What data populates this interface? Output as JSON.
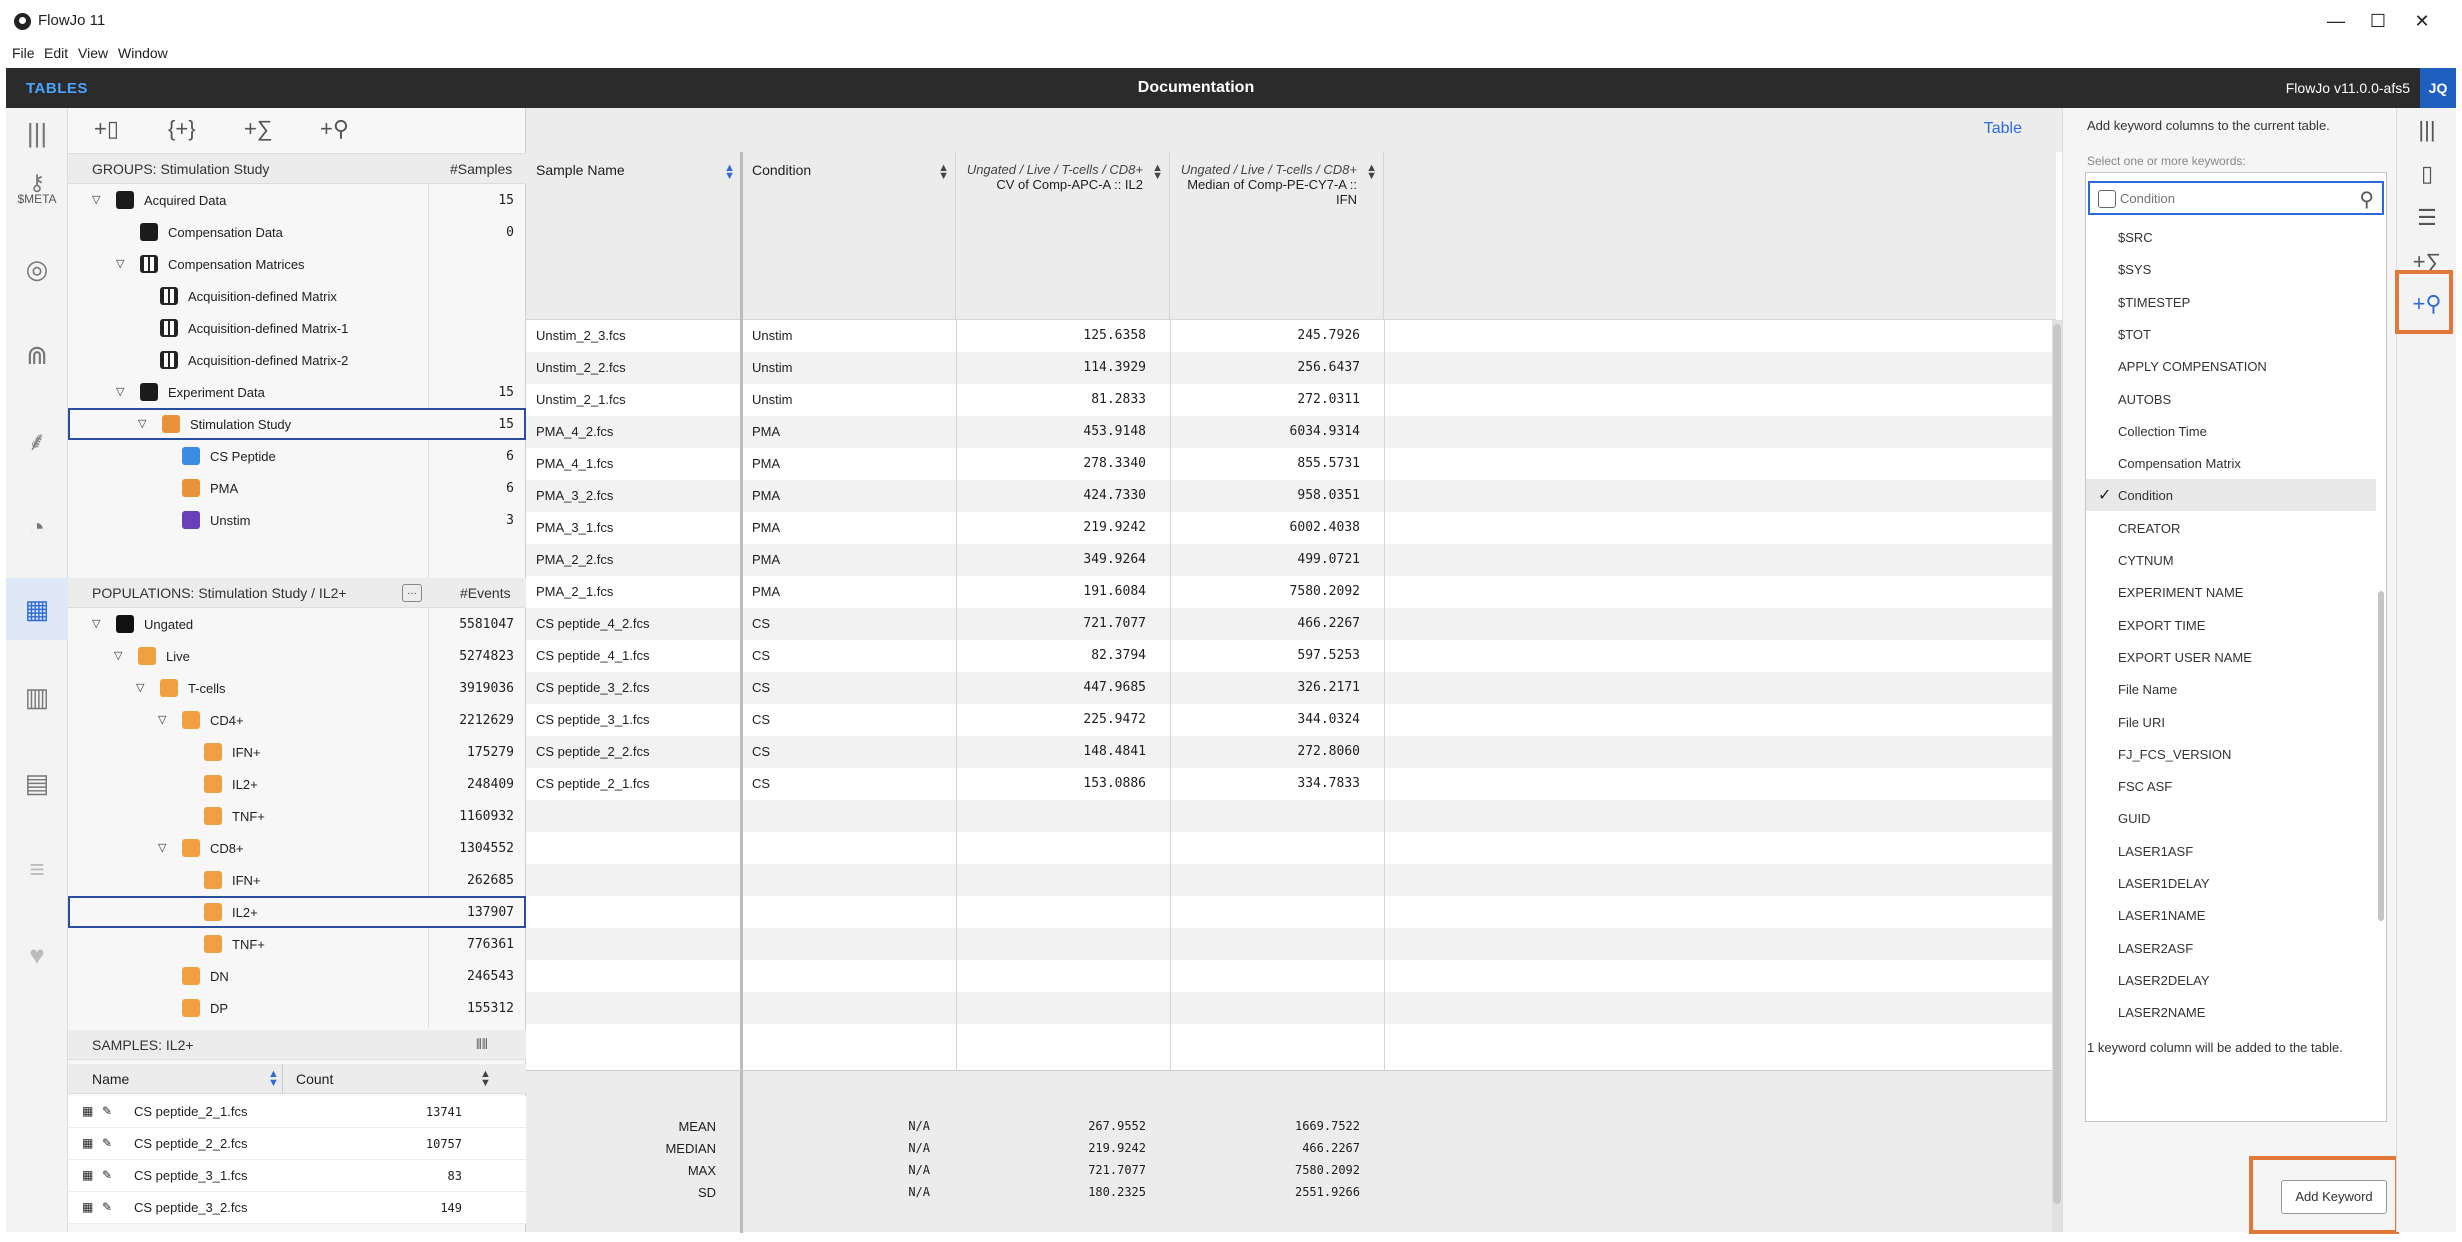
{
  "window": {
    "title": "FlowJo 11",
    "minimize": "—",
    "maximize": "☐",
    "close": "✕"
  },
  "menu": [
    "File",
    "Edit",
    "View",
    "Window"
  ],
  "topbar": {
    "section": "TABLES",
    "document": "Documentation",
    "version": "FlowJo v11.0.0-afs5",
    "user": "JQ"
  },
  "leftrail": {
    "meta_label": "$META"
  },
  "groups": {
    "header": "GROUPS: Stimulation Study",
    "count_header": "#Samples",
    "rows": [
      {
        "name": "Acquired Data",
        "value": "15"
      },
      {
        "name": "Compensation Data",
        "value": "0"
      },
      {
        "name": "Compensation Matrices",
        "value": ""
      },
      {
        "name": "Acquisition-defined Matrix",
        "value": ""
      },
      {
        "name": "Acquisition-defined Matrix-1",
        "value": ""
      },
      {
        "name": "Acquisition-defined Matrix-2",
        "value": ""
      },
      {
        "name": "Experiment Data",
        "value": "15"
      },
      {
        "name": "Stimulation Study",
        "value": "15"
      },
      {
        "name": "CS Peptide",
        "value": "6"
      },
      {
        "name": "PMA",
        "value": "6"
      },
      {
        "name": "Unstim",
        "value": "3"
      }
    ]
  },
  "populations": {
    "header": "POPULATIONS: Stimulation Study / IL2+",
    "count_header": "#Events",
    "rows": [
      {
        "name": "Ungated",
        "value": "5581047"
      },
      {
        "name": "Live",
        "value": "5274823"
      },
      {
        "name": "T-cells",
        "value": "3919036"
      },
      {
        "name": "CD4+",
        "value": "2212629"
      },
      {
        "name": "IFN+",
        "value": "175279"
      },
      {
        "name": "IL2+",
        "value": "248409"
      },
      {
        "name": "TNF+",
        "value": "1160932"
      },
      {
        "name": "CD8+",
        "value": "1304552"
      },
      {
        "name": "IFN+",
        "value": "262685"
      },
      {
        "name": "IL2+",
        "value": "137907"
      },
      {
        "name": "TNF+",
        "value": "776361"
      },
      {
        "name": "DN",
        "value": "246543"
      },
      {
        "name": "DP",
        "value": "155312"
      }
    ]
  },
  "samples": {
    "header": "SAMPLES: IL2+",
    "col_name": "Name",
    "col_count": "Count",
    "rows": [
      {
        "name": "CS peptide_2_1.fcs",
        "count": "13741"
      },
      {
        "name": "CS peptide_2_2.fcs",
        "count": "10757"
      },
      {
        "name": "CS peptide_3_1.fcs",
        "count": "83"
      },
      {
        "name": "CS peptide_3_2.fcs",
        "count": "149"
      }
    ]
  },
  "table": {
    "label": "Table",
    "columns": [
      {
        "sub": "",
        "main": "Sample Name"
      },
      {
        "sub": "",
        "main": "Condition"
      },
      {
        "sub": "Ungated / Live / T-cells / CD8+",
        "main": "CV of Comp-APC-A :: IL2"
      },
      {
        "sub": "Ungated / Live / T-cells / CD8+",
        "main": "Median of Comp-PE-CY7-A :: IFN"
      }
    ],
    "rows": [
      {
        "sample": "Unstim_2_3.fcs",
        "condition": "Unstim",
        "cv": "125.6358",
        "median": "245.7926"
      },
      {
        "sample": "Unstim_2_2.fcs",
        "condition": "Unstim",
        "cv": "114.3929",
        "median": "256.6437"
      },
      {
        "sample": "Unstim_2_1.fcs",
        "condition": "Unstim",
        "cv": "81.2833",
        "median": "272.0311"
      },
      {
        "sample": "PMA_4_2.fcs",
        "condition": "PMA",
        "cv": "453.9148",
        "median": "6034.9314"
      },
      {
        "sample": "PMA_4_1.fcs",
        "condition": "PMA",
        "cv": "278.3340",
        "median": "855.5731"
      },
      {
        "sample": "PMA_3_2.fcs",
        "condition": "PMA",
        "cv": "424.7330",
        "median": "958.0351"
      },
      {
        "sample": "PMA_3_1.fcs",
        "condition": "PMA",
        "cv": "219.9242",
        "median": "6002.4038"
      },
      {
        "sample": "PMA_2_2.fcs",
        "condition": "PMA",
        "cv": "349.9264",
        "median": "499.0721"
      },
      {
        "sample": "PMA_2_1.fcs",
        "condition": "PMA",
        "cv": "191.6084",
        "median": "7580.2092"
      },
      {
        "sample": "CS peptide_4_2.fcs",
        "condition": "CS",
        "cv": "721.7077",
        "median": "466.2267"
      },
      {
        "sample": "CS peptide_4_1.fcs",
        "condition": "CS",
        "cv": "82.3794",
        "median": "597.5253"
      },
      {
        "sample": "CS peptide_3_2.fcs",
        "condition": "CS",
        "cv": "447.9685",
        "median": "326.2171"
      },
      {
        "sample": "CS peptide_3_1.fcs",
        "condition": "CS",
        "cv": "225.9472",
        "median": "344.0324"
      },
      {
        "sample": "CS peptide_2_2.fcs",
        "condition": "CS",
        "cv": "148.4841",
        "median": "272.8060"
      },
      {
        "sample": "CS peptide_2_1.fcs",
        "condition": "CS",
        "cv": "153.0886",
        "median": "334.7833"
      }
    ],
    "summary": [
      {
        "label": "MEAN",
        "condition": "N/A",
        "cv": "267.9552",
        "median": "1669.7522"
      },
      {
        "label": "MEDIAN",
        "condition": "N/A",
        "cv": "219.9242",
        "median": "466.2267"
      },
      {
        "label": "MAX",
        "condition": "N/A",
        "cv": "721.7077",
        "median": "7580.2092"
      },
      {
        "label": "SD",
        "condition": "N/A",
        "cv": "180.2325",
        "median": "2551.9266"
      }
    ]
  },
  "keywords": {
    "hint": "Add keyword columns to the current table.",
    "select_label": "Select one or more keywords:",
    "search_placeholder": "Condition",
    "items": [
      "$SRC",
      "$SYS",
      "$TIMESTEP",
      "$TOT",
      "APPLY COMPENSATION",
      "AUTOBS",
      "Collection Time",
      "Compensation Matrix",
      "Condition",
      "CREATOR",
      "CYTNUM",
      "EXPERIMENT NAME",
      "EXPORT TIME",
      "EXPORT USER NAME",
      "File Name",
      "File URI",
      "FJ_FCS_VERSION",
      "FSC ASF",
      "GUID",
      "LASER1ASF",
      "LASER1DELAY",
      "LASER1NAME",
      "LASER2ASF",
      "LASER2DELAY",
      "LASER2NAME"
    ],
    "checked": "Condition",
    "count_text": "1 keyword column will be added to the table.",
    "add_button": "Add Keyword"
  },
  "colors": {
    "accent": "#2f6bd8",
    "highlight": "#e2773a",
    "topbar": "#2b2b2b"
  }
}
